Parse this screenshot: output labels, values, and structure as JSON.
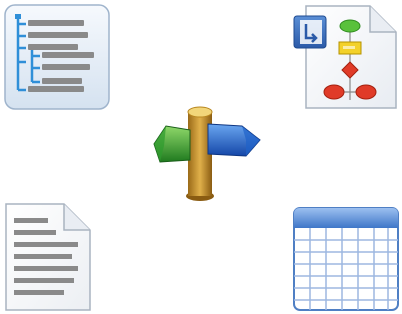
{
  "icons": [
    {
      "name": "tree-view-icon"
    },
    {
      "name": "flowchart-document-icon"
    },
    {
      "name": "signpost-icon"
    },
    {
      "name": "text-document-icon"
    },
    {
      "name": "spreadsheet-grid-icon"
    }
  ],
  "colors": {
    "tree_panel_top": "#f4f8fd",
    "tree_panel_bottom": "#dbe6f2",
    "tree_lines": "#2f8fd8",
    "text_bars": "#8a8a8a",
    "flow_green": "#59c13b",
    "flow_yellow": "#f3d12a",
    "flow_red": "#e03b28",
    "sign_green": "#2e9b2e",
    "sign_blue": "#1f62c9",
    "sign_post": "#c9922a",
    "grid_header": "#5a8fd8",
    "grid_lines": "#9db7e0"
  }
}
